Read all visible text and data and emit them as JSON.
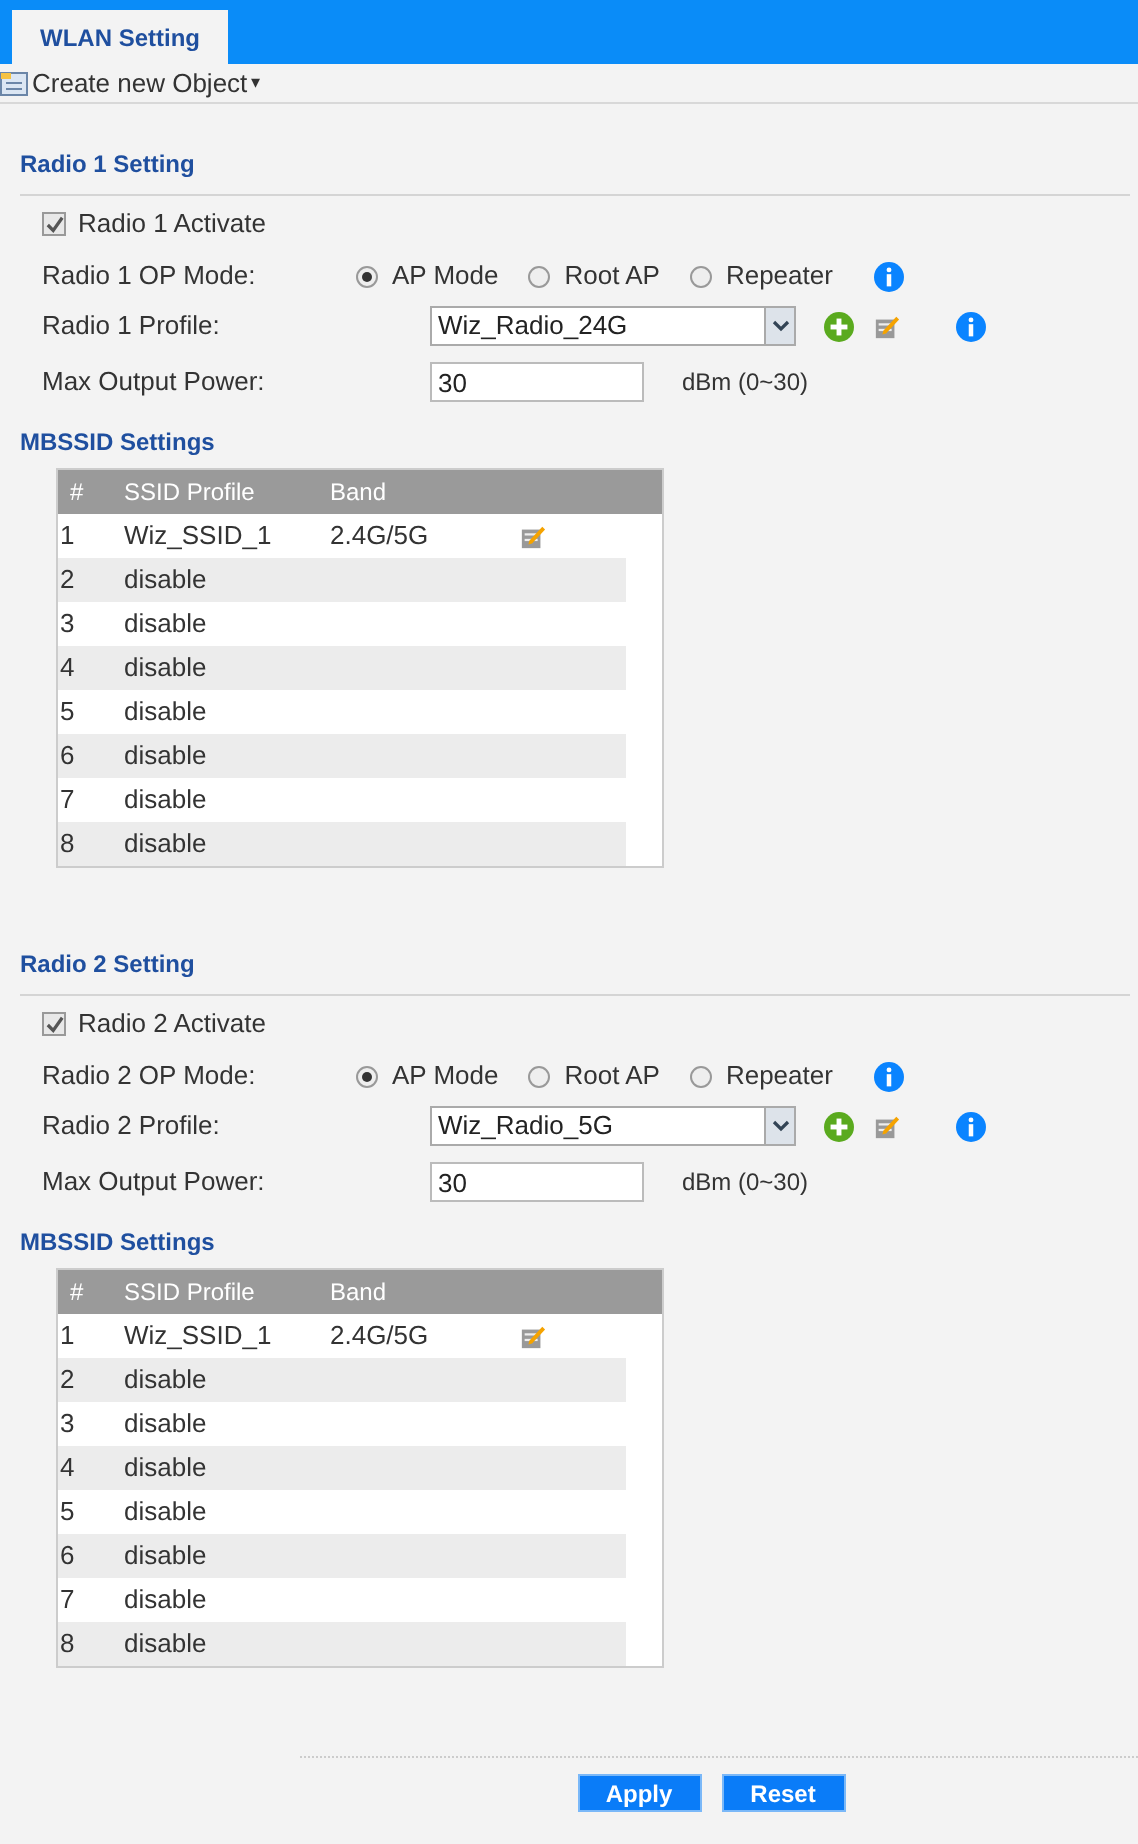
{
  "tab": {
    "label": "WLAN Setting",
    "selected": true
  },
  "toolbar": {
    "create_label": "Create new Object",
    "caret": "▾"
  },
  "radios": [
    {
      "title": "Radio 1 Setting",
      "activate": {
        "label": "Radio 1 Activate",
        "checked": true
      },
      "op_mode": {
        "label": "Radio 1 OP Mode:",
        "options": [
          {
            "label": "AP Mode",
            "selected": true
          },
          {
            "label": "Root AP",
            "selected": false
          },
          {
            "label": "Repeater",
            "selected": false
          }
        ]
      },
      "profile": {
        "label": "Radio 1 Profile:",
        "value": "Wiz_Radio_24G"
      },
      "power": {
        "label": "Max Output Power:",
        "value": "30",
        "unit": "dBm (0~30)"
      },
      "mbssid": {
        "title": "MBSSID Settings",
        "columns": [
          "#",
          "SSID Profile",
          "Band"
        ],
        "rows": [
          {
            "num": "1",
            "profile": "Wiz_SSID_1",
            "band": "2.4G/5G",
            "editable": true
          },
          {
            "num": "2",
            "profile": "disable",
            "editable": false
          },
          {
            "num": "3",
            "profile": "disable",
            "editable": false
          },
          {
            "num": "4",
            "profile": "disable",
            "editable": false
          },
          {
            "num": "5",
            "profile": "disable",
            "editable": false
          },
          {
            "num": "6",
            "profile": "disable",
            "editable": false
          },
          {
            "num": "7",
            "profile": "disable",
            "editable": false
          },
          {
            "num": "8",
            "profile": "disable",
            "editable": false
          }
        ]
      }
    },
    {
      "title": "Radio 2 Setting",
      "activate": {
        "label": "Radio 2 Activate",
        "checked": true
      },
      "op_mode": {
        "label": "Radio 2 OP Mode:",
        "options": [
          {
            "label": "AP Mode",
            "selected": true
          },
          {
            "label": "Root AP",
            "selected": false
          },
          {
            "label": "Repeater",
            "selected": false
          }
        ]
      },
      "profile": {
        "label": "Radio 2 Profile:",
        "value": "Wiz_Radio_5G"
      },
      "power": {
        "label": "Max Output Power:",
        "value": "30",
        "unit": "dBm (0~30)"
      },
      "mbssid": {
        "title": "MBSSID Settings",
        "columns": [
          "#",
          "SSID Profile",
          "Band"
        ],
        "rows": [
          {
            "num": "1",
            "profile": "Wiz_SSID_1",
            "band": "2.4G/5G",
            "editable": true
          },
          {
            "num": "2",
            "profile": "disable",
            "editable": false
          },
          {
            "num": "3",
            "profile": "disable",
            "editable": false
          },
          {
            "num": "4",
            "profile": "disable",
            "editable": false
          },
          {
            "num": "5",
            "profile": "disable",
            "editable": false
          },
          {
            "num": "6",
            "profile": "disable",
            "editable": false
          },
          {
            "num": "7",
            "profile": "disable",
            "editable": false
          },
          {
            "num": "8",
            "profile": "disable",
            "editable": false
          }
        ]
      }
    }
  ],
  "buttons": [
    "Apply",
    "Reset"
  ]
}
